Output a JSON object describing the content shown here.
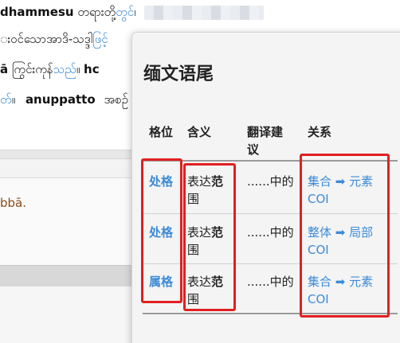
{
  "background": {
    "line1": {
      "pali": "dhammesu",
      "my": "တရားတို့",
      "link": "တွင်",
      "end": "၊"
    },
    "line2": {
      "my": "းဝင်သောအာဒိ-သဒ္ဒါ",
      "link": "ဖြင့်"
    },
    "line3": {
      "pali1": "ā",
      "my1": "ကြွင်းကုန်",
      "link": "သည်",
      "end": "။",
      "pali2": "hc"
    },
    "line4": {
      "link": "တ်",
      "end": "။",
      "pali": "anuppatto",
      "my": "အစဉ်"
    },
    "panel_text": "bbā."
  },
  "popup": {
    "title": "缅文语尾",
    "headers": {
      "case": "格位",
      "meaning": "含义",
      "translation_1": "翻译建",
      "translation_2": "议",
      "relation": "关系"
    },
    "rows": [
      {
        "case": "处格",
        "meaning_1": "表达",
        "meaning_bold_1": "范",
        "meaning_2": "围",
        "translation": "......中的",
        "relation_1": "集合 ➡ 元素",
        "relation_2": "COI"
      },
      {
        "case": "处格",
        "meaning_1": "表达",
        "meaning_bold_1": "范",
        "meaning_2": "围",
        "translation": "......中的",
        "relation_1": "整体 ➡ 局部",
        "relation_2": "COI"
      },
      {
        "case": "属格",
        "meaning_1": "表达",
        "meaning_bold_1": "范",
        "meaning_2": "围",
        "translation": "......中的",
        "relation_1": "集合 ➡ 元素",
        "relation_2": "COI"
      }
    ]
  },
  "colors": {
    "link": "#3d8bd6",
    "annotation": "#e02020",
    "panel_text": "#8a4a1a"
  }
}
